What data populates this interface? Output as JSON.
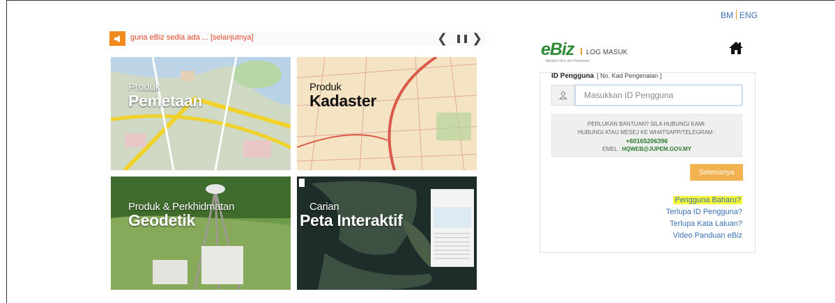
{
  "lang": {
    "bm": "BM",
    "eng": "ENG"
  },
  "ticker": {
    "message": "guna eBiz sedia ada ... [selanjutnya]",
    "prev": "❮",
    "pause": "❚❚",
    "next": "❯"
  },
  "tiles": [
    {
      "small": "Produk",
      "big": "Pemetaan"
    },
    {
      "small": "Produk",
      "big": "Kadaster"
    },
    {
      "small": "Produk & Perkhidmatan",
      "big": "Geodetik"
    },
    {
      "small": "Carian",
      "big": "Peta Interaktif"
    }
  ],
  "login": {
    "logo": "eBiz",
    "logo_sub": "Jabatan Ukur dan Pemetaan",
    "title": "LOG MASUK",
    "id_label": "ID Pengguna",
    "id_hint": "[ No. Kad Pengenalan ]",
    "id_placeholder": "Masukkan ID Pengguna",
    "help_line1": "PERLUKAN BANTUAN? SILA HUBUNGI KAMI.",
    "help_line2": "HUBUNGI ATAU MESEJ KE WHATSAPP/TELEGRAM :",
    "help_phone": "+60165206396",
    "help_email_label": "EMEL :",
    "help_email": "HQWEB@JUPEM.GOV.MY",
    "submit": "Seterusnya",
    "links": {
      "new_user": "Pengguna Baharu?",
      "forgot_id": "Terlupa ID Pengguna?",
      "forgot_password": "Terlupa Kata Laluan?",
      "video_guide": "Video Panduan eBiz"
    }
  },
  "colors": {
    "accent": "#f08a1c",
    "button": "#f1b24f",
    "link": "#3a6fb0",
    "highlight": "#f7f73a",
    "brand_green": "#2f8a36"
  }
}
